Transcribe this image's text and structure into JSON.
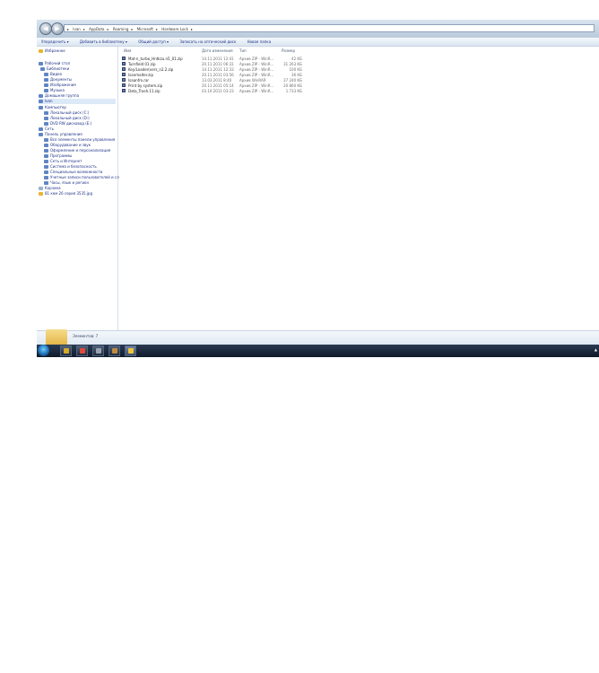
{
  "address": {
    "crumbs": [
      "Ivan",
      "AppData",
      "Roaming",
      "Microsoft",
      "Hardware Lock"
    ]
  },
  "toolbar": {
    "items": [
      "Упорядочить ▾",
      "Добавить в библиотеку ▾",
      "Общий доступ ▾",
      "Записать на оптический диск",
      "Новая папка"
    ]
  },
  "nav": {
    "items": [
      {
        "label": "Избранное",
        "icon": "star-icon"
      },
      {
        "label": "Рабочий стол",
        "icon": "desktop-icon"
      },
      {
        "label": "Библиотеки",
        "icon": "libraries-icon"
      },
      {
        "label": "Видео",
        "icon": "video-icon"
      },
      {
        "label": "Документы",
        "icon": "documents-icon"
      },
      {
        "label": "Изображения",
        "icon": "pictures-icon"
      },
      {
        "label": "Музыка",
        "icon": "music-icon"
      },
      {
        "label": "Домашняя группа",
        "icon": "homegroup-icon"
      },
      {
        "label": "Ivan",
        "icon": "user-folder-icon",
        "selected": true
      },
      {
        "label": "Компьютер",
        "icon": "computer-icon"
      },
      {
        "label": "Локальный диск (C:)",
        "icon": "drive-icon"
      },
      {
        "label": "Локальный диск (D:)",
        "icon": "drive-icon"
      },
      {
        "label": "DVD RW дисковод (E:)",
        "icon": "dvd-icon"
      },
      {
        "label": "Сеть",
        "icon": "network-icon"
      },
      {
        "label": "Панель управления",
        "icon": "control-panel-icon"
      },
      {
        "label": "Все элементы панели управления",
        "icon": "control-panel-icon"
      },
      {
        "label": "Оборудование и звук",
        "icon": "hardware-icon"
      },
      {
        "label": "Оформление и персонализация",
        "icon": "personalization-icon"
      },
      {
        "label": "Программы",
        "icon": "programs-icon"
      },
      {
        "label": "Сеть и Интернет",
        "icon": "network-icon"
      },
      {
        "label": "Система и безопасность",
        "icon": "security-icon"
      },
      {
        "label": "Специальные возможности",
        "icon": "accessibility-icon"
      },
      {
        "label": "Учетные записи пользователей и сл",
        "icon": "users-icon"
      },
      {
        "label": "Часы, язык и регион",
        "icon": "clock-icon"
      },
      {
        "label": "Корзина",
        "icon": "recycle-bin-icon"
      },
      {
        "label": "81 кем 26 серия 3535.jpg",
        "icon": "folder-icon"
      }
    ]
  },
  "columns": {
    "name": "Имя",
    "date": "Дата изменения",
    "type": "Тип",
    "size": "Размер"
  },
  "files": [
    {
      "name": "Mat-n_turbo_Hntkzu.n5_01.zip",
      "date": "14.11.2011 12:41",
      "type": "Архив ZIP - WinR...",
      "size": "42 КБ"
    },
    {
      "name": "Turnfield 01.zip",
      "date": "20.11.2011 06:31",
      "type": "Архив ZIP - WinR...",
      "size": "31 263 КБ"
    },
    {
      "name": "Key/Loader(vers_n2.2.zip",
      "date": "14.11.2011 12:33",
      "type": "Архив ZIP - WinR...",
      "size": "100 КБ"
    },
    {
      "name": "Isanmalter.zip",
      "date": "20.11.2011 03:56",
      "type": "Архив ZIP - WinR...",
      "size": "36 КБ"
    },
    {
      "name": "Isaanfro.rar",
      "date": "13.03.2011 8:40",
      "type": "Архив WinRAR",
      "size": "27 240 КБ"
    },
    {
      "name": "Print by system.zip",
      "date": "20.11.2011 05:14",
      "type": "Архив ZIP - WinR...",
      "size": "20 860 КБ"
    },
    {
      "name": "Data_Trash.11.zip",
      "date": "03.10.2011 03:23",
      "type": "Архив ZIP - WinR...",
      "size": "1 733 КБ"
    }
  ],
  "details": {
    "count": "Элементов: 7"
  },
  "taskbar": {
    "buttons": [
      {
        "name": "start-button"
      },
      {
        "name": "taskbar-app-1",
        "color": "#d4a92c"
      },
      {
        "name": "taskbar-chrome",
        "color": "#e0483b"
      },
      {
        "name": "taskbar-app-3",
        "color": "#9aa3b0"
      },
      {
        "name": "taskbar-app-4",
        "color": "#c08a3e"
      },
      {
        "name": "taskbar-explorer",
        "color": "#f0c33c"
      }
    ],
    "clock": "▲"
  }
}
